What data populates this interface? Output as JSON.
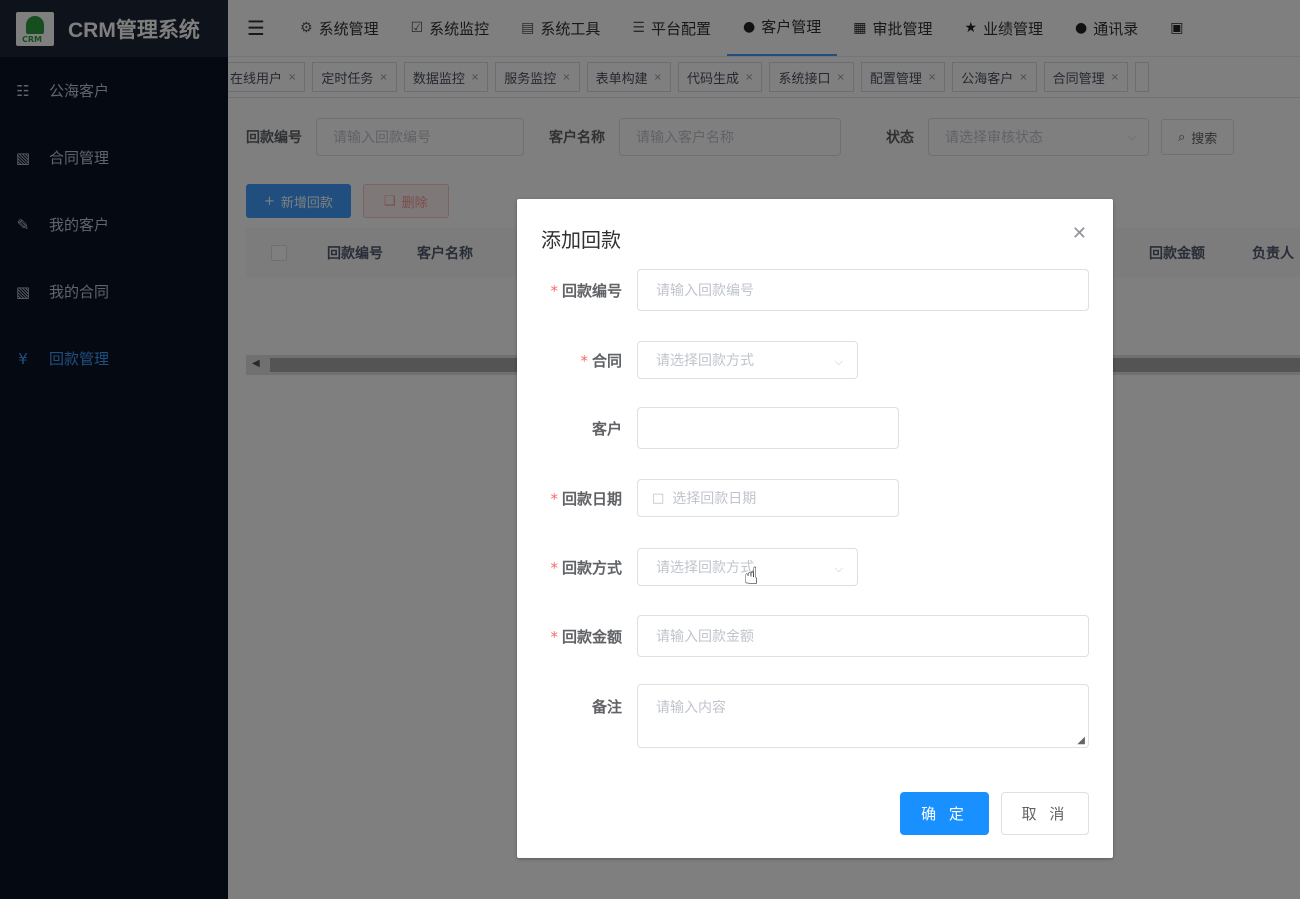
{
  "sidebar": {
    "title": "CRM管理系统",
    "items": [
      {
        "label": "公海客户",
        "icon": "sitemap-icon"
      },
      {
        "label": "合同管理",
        "icon": "document-copy-icon"
      },
      {
        "label": "我的客户",
        "icon": "edit-icon"
      },
      {
        "label": "我的合同",
        "icon": "document-copy-icon"
      },
      {
        "label": "回款管理",
        "icon": "yen-icon"
      }
    ]
  },
  "topnav": {
    "items": [
      {
        "label": "系统管理"
      },
      {
        "label": "系统监控"
      },
      {
        "label": "系统工具"
      },
      {
        "label": "平台配置"
      },
      {
        "label": "客户管理"
      },
      {
        "label": "审批管理"
      },
      {
        "label": "业绩管理"
      },
      {
        "label": "通讯录"
      }
    ],
    "active": "客户管理"
  },
  "tags": [
    "在线用户",
    "定时任务",
    "数据监控",
    "服务监控",
    "表单构建",
    "代码生成",
    "系统接口",
    "配置管理",
    "公海客户",
    "合同管理"
  ],
  "search": {
    "code_label": "回款编号",
    "code_placeholder": "请输入回款编号",
    "customer_label": "客户名称",
    "customer_placeholder": "请输入客户名称",
    "status_label": "状态",
    "status_placeholder": "请选择审核状态",
    "search_button": "搜索"
  },
  "toolbar": {
    "add_button": "新增回款",
    "delete_button": "删除"
  },
  "table": {
    "columns": [
      "回款编号",
      "客户名称",
      "回款金额",
      "负责人"
    ]
  },
  "dialog": {
    "title": "添加回款",
    "fields": {
      "code": {
        "label": "回款编号",
        "placeholder": "请输入回款编号"
      },
      "contract": {
        "label": "合同",
        "placeholder": "请选择回款方式"
      },
      "customer": {
        "label": "客户",
        "placeholder": ""
      },
      "date": {
        "label": "回款日期",
        "placeholder": "选择回款日期"
      },
      "method": {
        "label": "回款方式",
        "placeholder": "请选择回款方式"
      },
      "amount": {
        "label": "回款金额",
        "placeholder": "请输入回款金额"
      },
      "remark": {
        "label": "备注",
        "placeholder": "请输入内容"
      }
    },
    "confirm_button": "确 定",
    "cancel_button": "取 消"
  },
  "colors": {
    "primary": "#409eff",
    "sidebar_bg": "#0a1224",
    "danger_text": "#f89898",
    "required": "#f56c6c"
  }
}
